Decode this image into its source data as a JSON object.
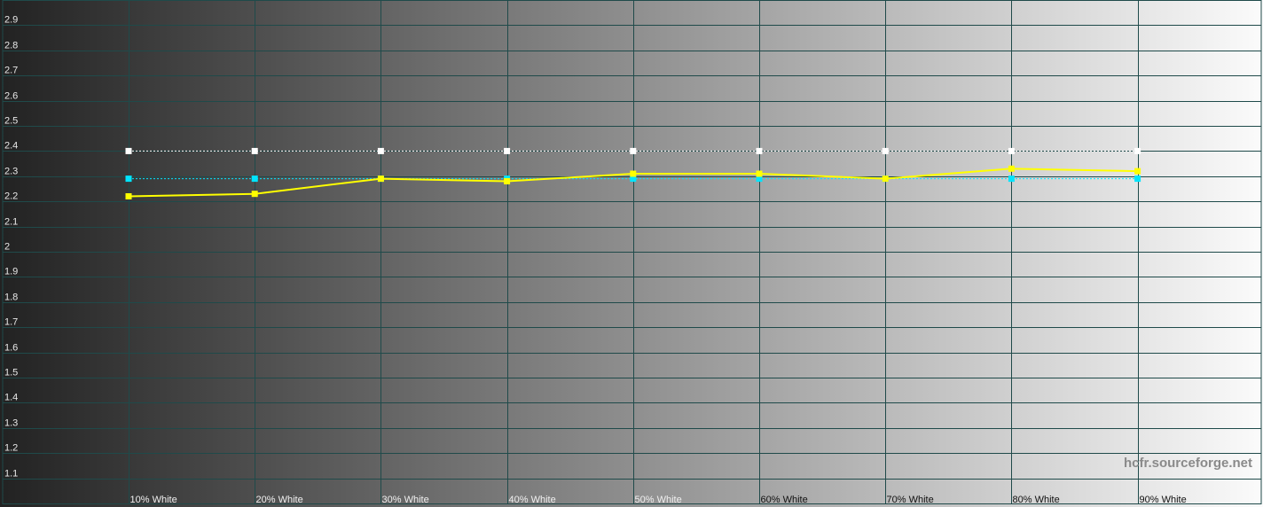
{
  "chart_data": {
    "type": "line",
    "categories": [
      "10% White",
      "20% White",
      "30% White",
      "40% White",
      "50% White",
      "60% White",
      "70% White",
      "80% White",
      "90% White"
    ],
    "series": [
      {
        "values": [
          2.22,
          2.23,
          2.29,
          2.28,
          2.31,
          2.31,
          2.29,
          2.33,
          2.32
        ],
        "color": "#ffff00",
        "style": "solid"
      },
      {
        "values": [
          2.29,
          2.29,
          2.29,
          2.29,
          2.29,
          2.29,
          2.29,
          2.29,
          2.29
        ],
        "color": "#00e5ff",
        "style": "dotted"
      },
      {
        "values": [
          2.4,
          2.4,
          2.4,
          2.4,
          2.4,
          2.4,
          2.4,
          2.4,
          2.4
        ],
        "color": "#ffffff",
        "style": "dotted"
      }
    ],
    "ylim": [
      1.0,
      3.0
    ],
    "yticks": [
      "1.1",
      "1.2",
      "1.3",
      "1.4",
      "1.5",
      "1.6",
      "1.7",
      "1.8",
      "1.9",
      "2",
      "2.1",
      "2.2",
      "2.3",
      "2.4",
      "2.5",
      "2.6",
      "2.7",
      "2.8",
      "2.9"
    ],
    "grid": true,
    "background": "grayscale gradient dark to white",
    "grid_color": "#1f4a4a",
    "watermark": "hcfr.sourceforge.net"
  }
}
